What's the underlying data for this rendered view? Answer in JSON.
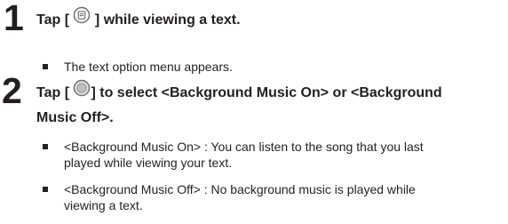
{
  "steps": [
    {
      "number": "1",
      "title_before_icon": "Tap [ ",
      "icon": "menu-icon",
      "title_after_icon": " ] while viewing a text.",
      "bullets": [
        {
          "lines": [
            "The text option menu appears."
          ]
        }
      ]
    },
    {
      "number": "2",
      "title_before_icon": "Tap [ ",
      "icon": "select-circle-icon",
      "title_after_icon": "] to select <Background Music On> or <Background",
      "title_line2": "Music Off>.",
      "bullets": [
        {
          "lines": [
            "<Background Music On> : You can listen to the song that you last",
            "played while viewing your text."
          ]
        },
        {
          "lines": [
            "<Background Music Off> : No background music is played while",
            "viewing a text."
          ]
        }
      ]
    }
  ],
  "colors": {
    "text": "#231f20",
    "icon_stroke": "#6d6e71",
    "icon_fill": "#bcbec0"
  }
}
